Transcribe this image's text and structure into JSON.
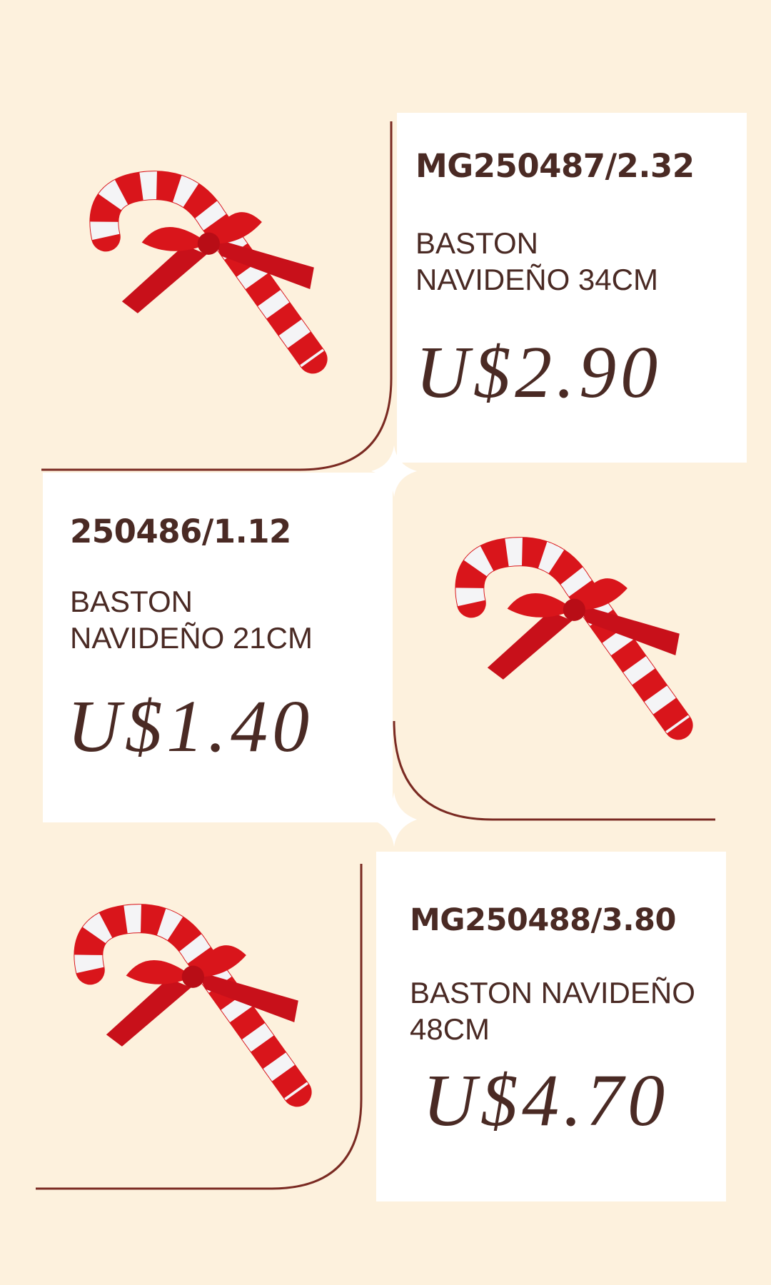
{
  "colors": {
    "background": "#fdf1dd",
    "card": "#ffffff",
    "text": "#4a2a24",
    "line": "#7a2a22",
    "cane_red": "#d9151b",
    "cane_white": "#f4f4f6"
  },
  "products": [
    {
      "code": "MG250487/2.32",
      "description": "BASTON NAVIDEÑO 34CM",
      "price": "U$2.90",
      "image": "candy-cane-with-red-bow"
    },
    {
      "code": "250486/1.12",
      "description": "BASTON NAVIDEÑO 21CM",
      "price": "U$1.40",
      "image": "candy-cane-with-red-bow"
    },
    {
      "code": "MG250488/3.80",
      "description": "BASTON NAVIDEÑO 48CM",
      "price": "U$4.70",
      "image": "candy-cane-with-red-bow"
    }
  ]
}
